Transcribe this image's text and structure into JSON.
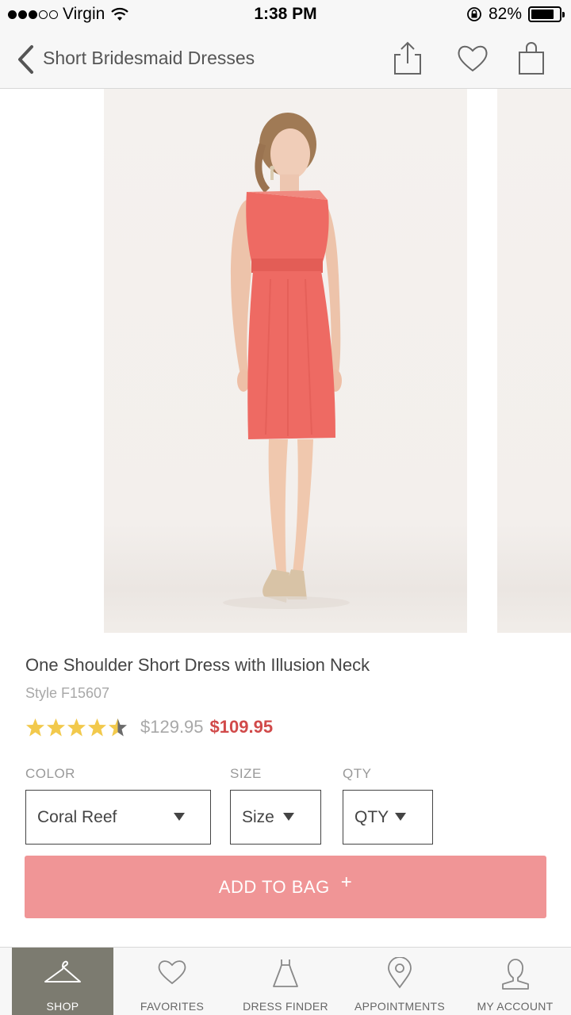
{
  "status_bar": {
    "carrier": "Virgin",
    "time": "1:38 PM",
    "battery": "82%",
    "battery_level": 0.82,
    "signal_bars_filled": 3,
    "signal_bars_total": 5
  },
  "header": {
    "title": "Short Bridesmaid Dresses",
    "icons": [
      "back-chevron-icon",
      "share-icon",
      "heart-icon",
      "shopping-bag-icon"
    ]
  },
  "product": {
    "name": "One Shoulder Short Dress with Illusion Neck",
    "style": "Style F15607",
    "rating": 4.5,
    "price_original": "$129.95",
    "price_sale": "$109.95",
    "dress_color": "#ee6a63"
  },
  "options": {
    "color_label": "COLOR",
    "color_value": "Coral Reef",
    "size_label": "SIZE",
    "size_value": "Size",
    "qty_label": "QTY",
    "qty_value": "QTY"
  },
  "add_to_bag": {
    "label": "ADD TO BAG",
    "icon": "+",
    "color": "#f09596"
  },
  "tab_bar": {
    "tabs": [
      {
        "label": "SHOP",
        "icon": "hanger-icon",
        "active": true
      },
      {
        "label": "FAVORITES",
        "icon": "heart-icon",
        "active": false
      },
      {
        "label": "DRESS FINDER",
        "icon": "dress-icon",
        "active": false
      },
      {
        "label": "APPOINTMENTS",
        "icon": "location-pin-icon",
        "active": false
      },
      {
        "label": "MY ACCOUNT",
        "icon": "person-icon",
        "active": false
      }
    ],
    "active_color": "#7c7b70"
  }
}
